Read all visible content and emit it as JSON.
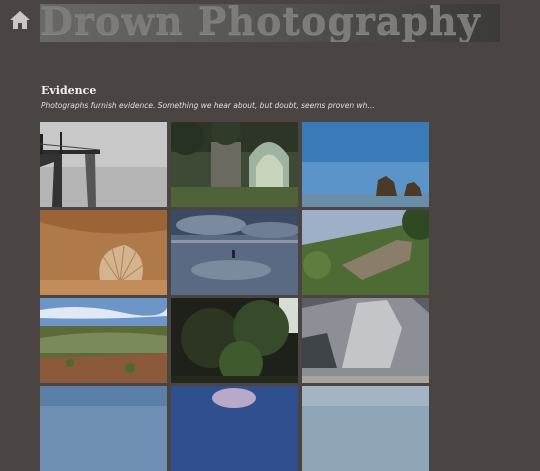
{
  "site": {
    "title": "Drown Photography"
  },
  "nav": {
    "home_icon": "home-icon"
  },
  "gallery": {
    "title": "Evidence",
    "description": "Photographs furnish evidence. Something we hear about, but doubt, seems proven wh…",
    "thumbnails": [
      {
        "subject": "pier-in-fog"
      },
      {
        "subject": "stone-archway-ruin"
      },
      {
        "subject": "sea-stacks"
      },
      {
        "subject": "fossil-shell"
      },
      {
        "subject": "beach-reflection"
      },
      {
        "subject": "hillside-ruin"
      },
      {
        "subject": "coastal-scrubland"
      },
      {
        "subject": "dark-trees"
      },
      {
        "subject": "white-cliffs"
      },
      {
        "subject": "sky"
      },
      {
        "subject": "sky-tree"
      },
      {
        "subject": "sky"
      }
    ]
  }
}
